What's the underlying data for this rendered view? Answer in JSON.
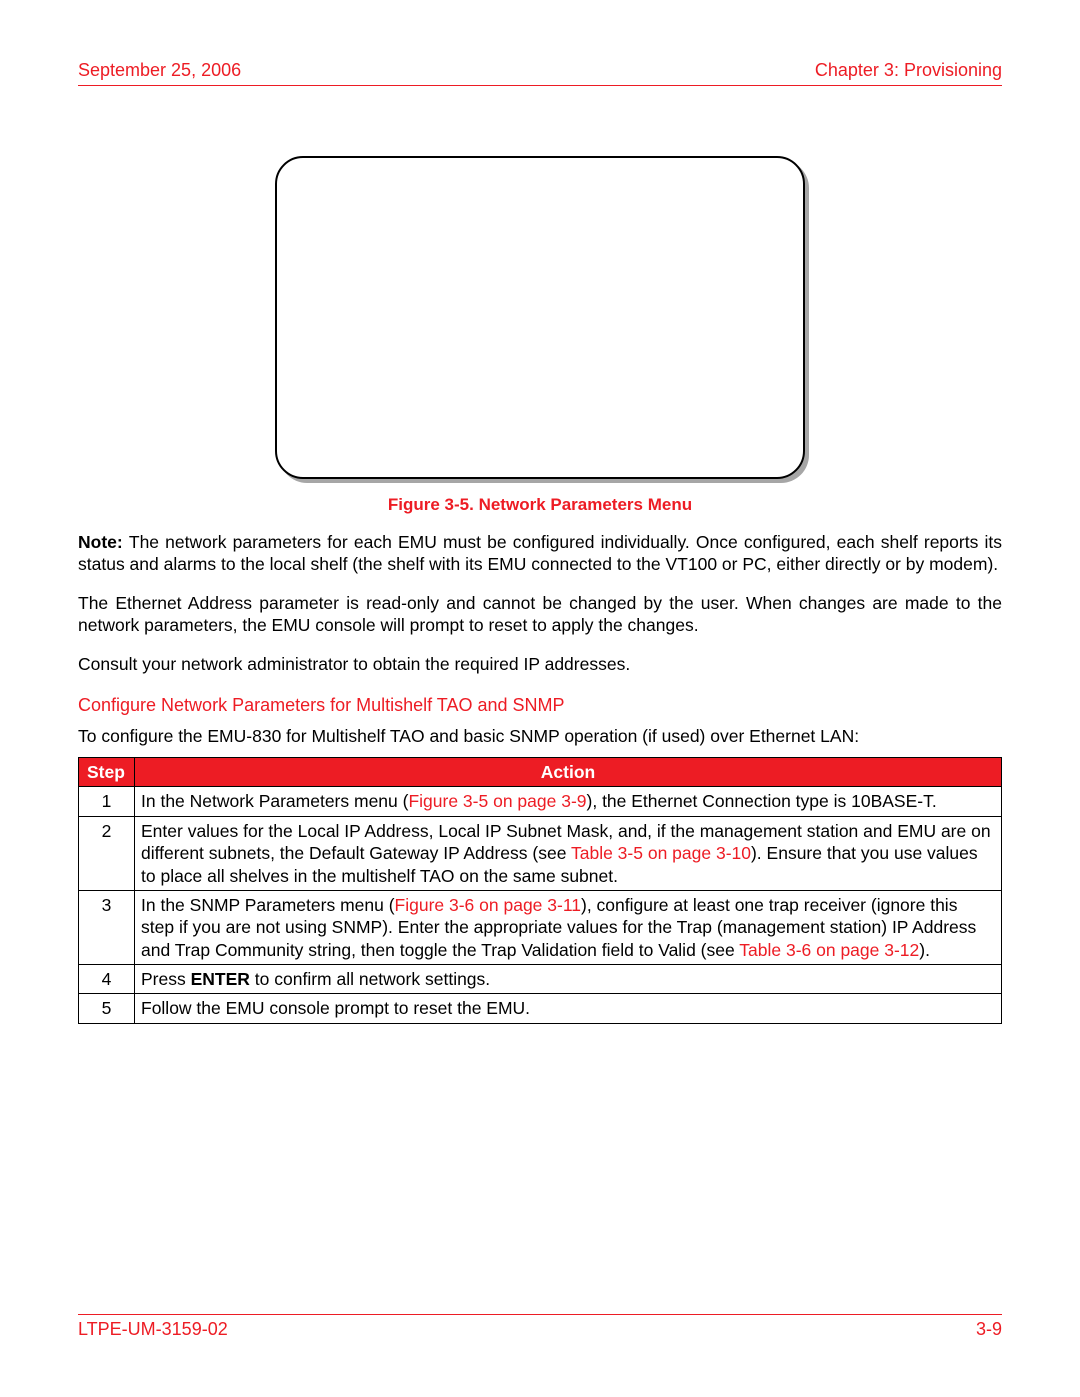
{
  "header": {
    "date": "September 25, 2006",
    "chapter": "Chapter 3: Provisioning"
  },
  "figure": {
    "caption": "Figure 3-5. Network Parameters Menu"
  },
  "paragraphs": {
    "note_label": "Note: ",
    "note_text": "The network parameters for each EMU must be configured individually. Once configured, each shelf reports its status and alarms to the local shelf (the shelf with its EMU connected to the VT100 or PC, either directly or by modem).",
    "p2": "The Ethernet Address parameter is read-only and cannot be changed by the user. When changes are made to the network parameters, the EMU console will prompt to reset to apply the changes.",
    "p3": "Consult your network administrator to obtain the required IP addresses."
  },
  "section_heading": "Configure Network Parameters for Multishelf TAO and SNMP",
  "intro": "To configure the EMU-830 for Multishelf TAO and basic SNMP operation (if used) over Ethernet LAN:",
  "table": {
    "h_step": "Step",
    "h_action": "Action",
    "row1": {
      "step": "1",
      "a": "In the Network Parameters menu (",
      "ref": "Figure 3-5 on page 3-9",
      "b": "), the Ethernet Connection type is 10BASE-T."
    },
    "row2": {
      "step": "2",
      "a": "Enter values for the Local IP Address, Local IP Subnet Mask, and, if the management station and EMU are on different subnets, the Default Gateway IP Address (see ",
      "ref": "Table 3-5 on page 3-10",
      "b": "). Ensure that you use values to place all shelves in the multishelf TAO on the same subnet."
    },
    "row3": {
      "step": "3",
      "a": "In the SNMP Parameters menu (",
      "ref1": "Figure 3-6 on page 3-11",
      "b": "), configure at least one trap receiver (ignore this step if you are not using SNMP). Enter the appropriate values for the Trap (management station) IP Address and Trap Community string, then toggle the Trap Validation field to Valid (see ",
      "ref2": "Table 3-6 on page 3-12",
      "c": ")."
    },
    "row4": {
      "step": "4",
      "a": "Press ",
      "bold": "ENTER",
      "b": " to confirm all network settings."
    },
    "row5": {
      "step": "5",
      "a": "Follow the EMU console prompt to reset the EMU."
    }
  },
  "footer": {
    "doc_id": "LTPE-UM-3159-02",
    "page_num": "3-9"
  }
}
